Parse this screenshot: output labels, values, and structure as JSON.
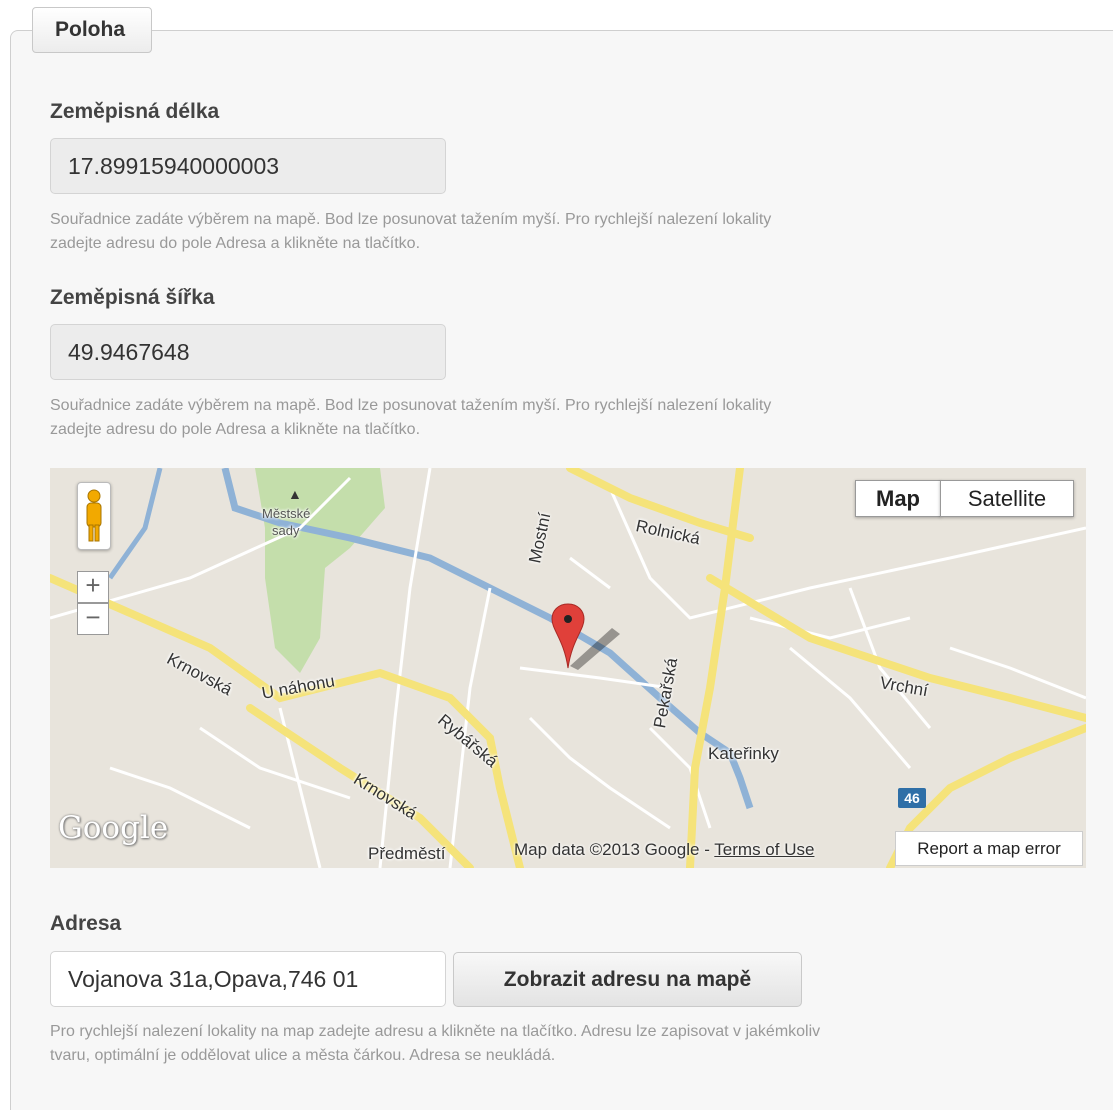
{
  "legend": "Poloha",
  "longitude": {
    "label": "Zeměpisná délka",
    "value": "17.89915940000003",
    "hint_line1": "Souřadnice zadáte výběrem na mapě. Bod lze posunovat tažením myší. Pro rychlejší nalezení lokality",
    "hint_line2": "zadejte adresu do pole Adresa a klikněte na tlačítko."
  },
  "latitude": {
    "label": "Zeměpisná šířka",
    "value": "49.9467648",
    "hint_line1": "Souřadnice zadáte výběrem na mapě. Bod lze posunovat tažením myší. Pro rychlejší nalezení lokality",
    "hint_line2": "zadejte adresu do pole Adresa a klikněte na tlačítko."
  },
  "map": {
    "type_map": "Map",
    "type_satellite": "Satellite",
    "zoom_in": "+",
    "zoom_out": "−",
    "logo": "Google",
    "attribution": "Map data ©2013 Google - ",
    "terms": "Terms of Use",
    "report": "Report a map error",
    "labels": {
      "mestske": "Městské",
      "sady": "sady",
      "mostni": "Mostní",
      "rolnicka": "Rolnická",
      "krnovska1": "Krnovská",
      "nahonu": "U náhonu",
      "rybarska": "Rybářská",
      "krnovska2": "Krnovská",
      "pekarska": "Pekařská",
      "vrchni": "Vrchní",
      "katerinky": "Kateřinky",
      "predmesti": "Předměstí",
      "route": "46"
    },
    "colors": {
      "road": "#f5e37a",
      "river": "#8fb2d6",
      "park": "#c4deab",
      "marker": "#e0403a"
    }
  },
  "address": {
    "label": "Adresa",
    "value": "Vojanova 31a,Opava,746 01",
    "button": "Zobrazit adresu na mapě",
    "hint_line1": "Pro rychlejší nalezení lokality na map zadejte adresu a klikněte na tlačítko. Adresu lze zapisovat v jakémkoliv",
    "hint_line2": "tvaru, optimální je oddělovat ulice a města čárkou. Adresa se neukládá."
  }
}
